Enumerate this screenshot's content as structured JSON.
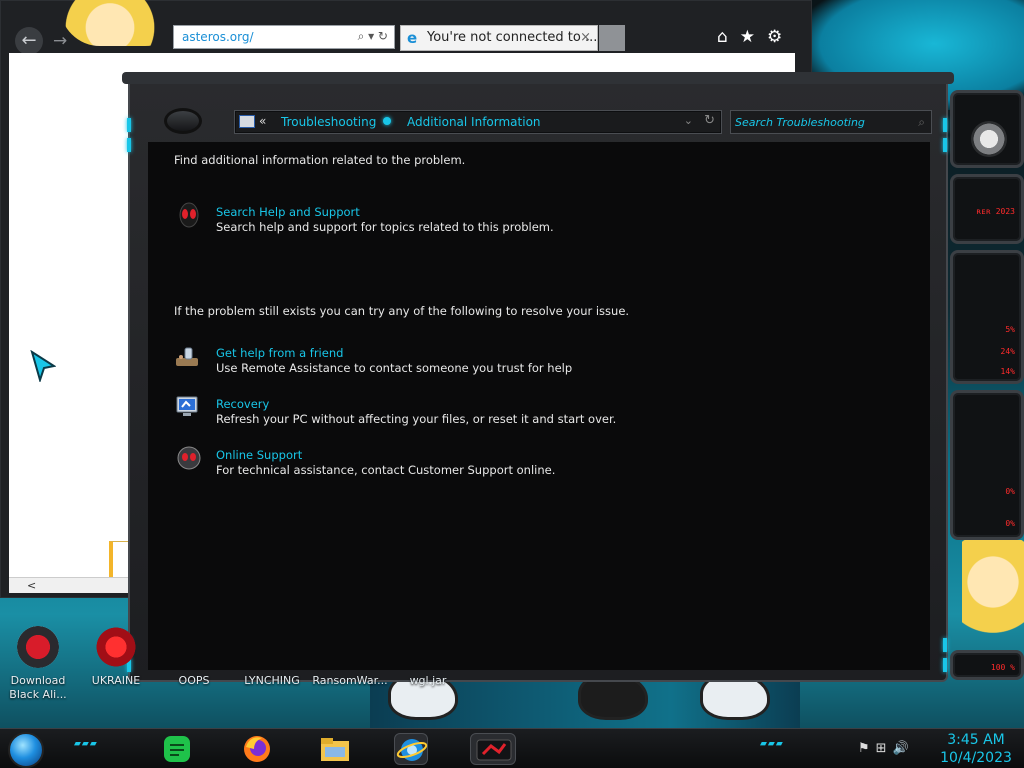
{
  "browser": {
    "address_text": "asteros.org/",
    "address_icons": "⌕ ▾ ↻",
    "tab_title": "You're not connected to ...",
    "tab_close": "×",
    "back_glyph": "←",
    "forward_glyph": "→",
    "tools_glyphs": "⌂★⚙",
    "hscroll_glyph": "<"
  },
  "troubleshooting": {
    "breadcrumb": {
      "chevron": "«",
      "item1": "Troubleshooting",
      "item2": "Additional Information",
      "dropdown_glyph": "⌄",
      "refresh_glyph": "↻"
    },
    "search_placeholder": "Search Troubleshooting",
    "search_icon": "⌕",
    "intro": "Find additional information related to the problem.",
    "help_support": {
      "title": "Search Help and Support",
      "desc": "Search help and support for topics related to this problem."
    },
    "still_exists": "If the problem still exists you can try any of the following to resolve your issue.",
    "options": [
      {
        "title": "Get help from a friend",
        "desc": "Use Remote Assistance to contact someone you trust for help",
        "icon": "remote-assistance-icon"
      },
      {
        "title": "Recovery",
        "desc": "Refresh your PC without affecting your files, or reset it and start over.",
        "icon": "recovery-icon"
      },
      {
        "title": "Online Support",
        "desc": "For technical assistance, contact Customer Support online.",
        "icon": "online-support-icon"
      }
    ]
  },
  "gadgets": {
    "red_text": [
      "ʀᴇʀ 2023",
      "5%",
      "24%",
      "14%",
      "0%",
      "0%",
      "100 %"
    ]
  },
  "desktop_icons": [
    {
      "label": "Download Black Ali..."
    },
    {
      "label": "UKRAINE"
    },
    {
      "label": "OOPS"
    },
    {
      "label": "LYNCHING"
    },
    {
      "label": "RansomWar..."
    },
    {
      "label": "wgl.jar"
    }
  ],
  "taskbar": {
    "dots": "▰▰▰",
    "tray_glyphs": "⚑⊞🔊",
    "time": "3:45 AM",
    "date": "10/4/2023"
  },
  "colors": {
    "accent_cyan": "#19c6e8",
    "gadget_red": "#ff2b2b",
    "window_body": "#0a0a0b"
  }
}
